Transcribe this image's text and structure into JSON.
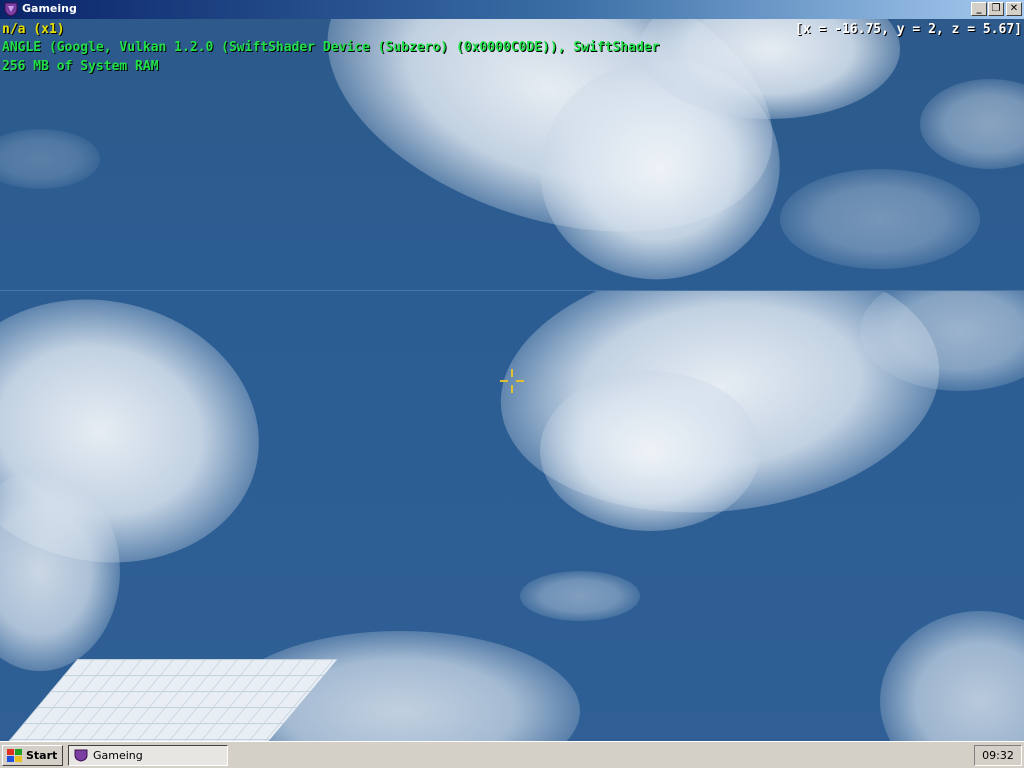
{
  "window": {
    "title": "Gameing",
    "icon": "app-shield-icon",
    "controls": {
      "minimize": "_",
      "restore": "❐",
      "close": "✕"
    }
  },
  "hud": {
    "line1": "n/a (x1)",
    "line2": "ANGLE (Google, Vulkan 1.2.0 (SwiftShader Device (Subzero) (0x0000C0DE)), SwiftShader",
    "line3": "256 MB of System RAM",
    "coords": "[x = -16.75, y = 2, z = 5.67]",
    "colors": {
      "line1": "#e6e000",
      "info": "#22e04a",
      "coords": "#ffffff",
      "crosshair": "#e0c030"
    }
  },
  "taskbar": {
    "start_label": "Start",
    "task_label": "Gameing",
    "clock": "09:32"
  }
}
